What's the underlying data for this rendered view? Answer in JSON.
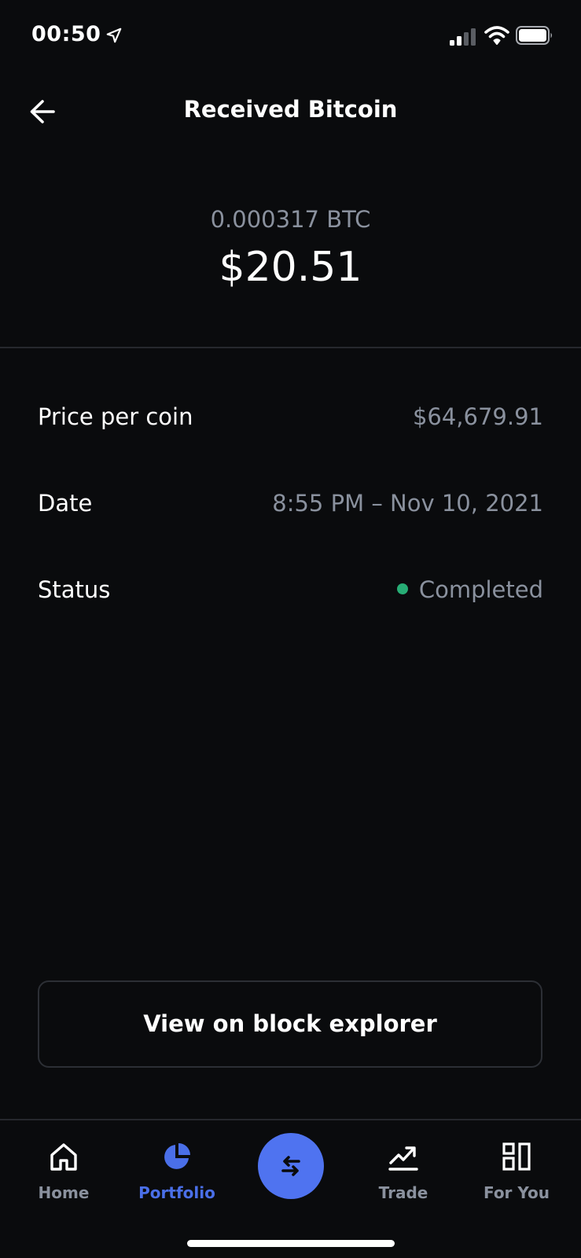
{
  "status_bar": {
    "time": "00:50"
  },
  "header": {
    "title": "Received Bitcoin"
  },
  "amount": {
    "crypto": "0.000317 BTC",
    "fiat": "$20.51"
  },
  "details": [
    {
      "label": "Price per coin",
      "value": "$64,679.91"
    },
    {
      "label": "Date",
      "value": "8:55 PM – Nov 10, 2021"
    },
    {
      "label": "Status",
      "value": "Completed"
    }
  ],
  "colors": {
    "status_completed": "#27ad75",
    "accent": "#4f73f0"
  },
  "actions": {
    "explorer_label": "View on block explorer"
  },
  "tab_bar": {
    "active": "Portfolio",
    "tabs": [
      {
        "label": "Home",
        "icon": "home-icon"
      },
      {
        "label": "Portfolio",
        "icon": "pie-chart-icon"
      },
      {
        "label": "",
        "icon": "swap-arrows-icon"
      },
      {
        "label": "Trade",
        "icon": "trending-up-icon"
      },
      {
        "label": "For You",
        "icon": "grid-layout-icon"
      }
    ]
  }
}
